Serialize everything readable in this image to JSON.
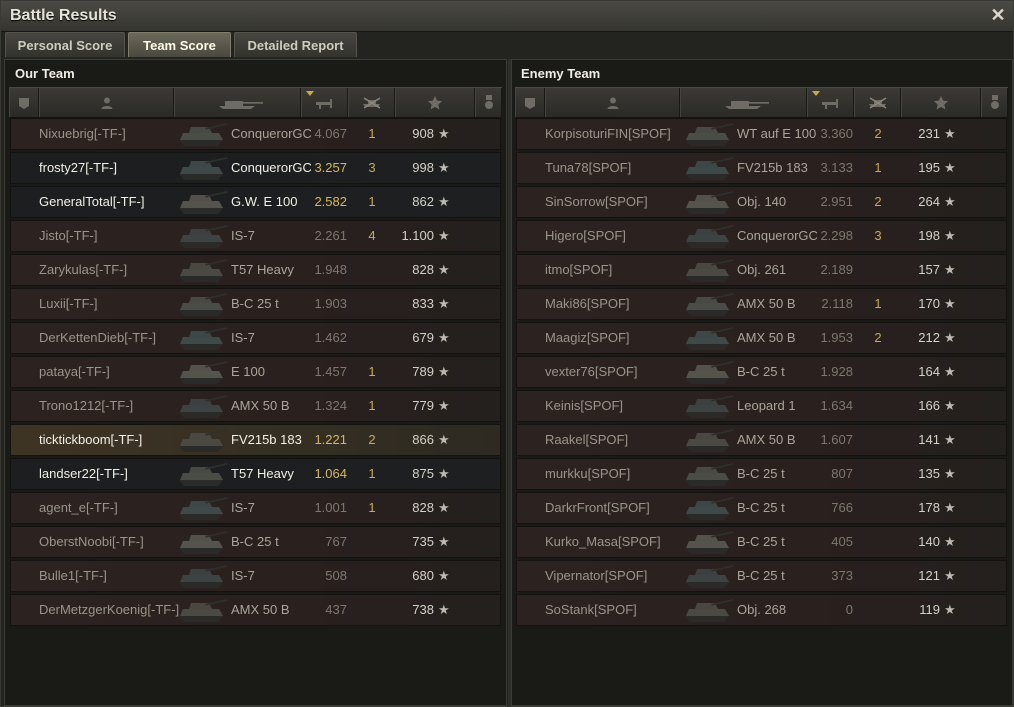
{
  "window": {
    "title": "Battle Results"
  },
  "tabs": [
    {
      "label": "Personal Score"
    },
    {
      "label": "Team Score"
    },
    {
      "label": "Detailed Report"
    }
  ],
  "icons": {
    "header": [
      "platoon-icon",
      "player-icon",
      "tank-icon",
      "damage-icon",
      "kills-icon",
      "xp-star-icon",
      "medal-icon"
    ],
    "close": "close-icon",
    "xp": "star-icon"
  },
  "colors": {
    "accent": "#c9aa58",
    "self_highlight": "#3e3424"
  },
  "our_team": {
    "title": "Our Team",
    "rows": [
      {
        "player": "Nixuebrig[-TF-]",
        "tank": "ConquerorGC",
        "ratio": "4.067",
        "kills": "1",
        "xp": "908",
        "bright": false
      },
      {
        "player": "frosty27[-TF-]",
        "tank": "ConquerorGC",
        "ratio": "3.257",
        "kills": "3",
        "xp": "998",
        "bright": true
      },
      {
        "player": "GeneralTotal[-TF-]",
        "tank": "G.W. E 100",
        "ratio": "2.582",
        "kills": "1",
        "xp": "862",
        "bright": true
      },
      {
        "player": "Jisto[-TF-]",
        "tank": "IS-7",
        "ratio": "2.261",
        "kills": "4",
        "xp": "1.100",
        "bright": false
      },
      {
        "player": "Zarykulas[-TF-]",
        "tank": "T57 Heavy",
        "ratio": "1.948",
        "kills": "",
        "xp": "828",
        "bright": false
      },
      {
        "player": "Luxii[-TF-]",
        "tank": "B-C 25 t",
        "ratio": "1.903",
        "kills": "",
        "xp": "833",
        "bright": false
      },
      {
        "player": "DerKettenDieb[-TF-]",
        "tank": "IS-7",
        "ratio": "1.462",
        "kills": "",
        "xp": "679",
        "bright": false
      },
      {
        "player": "pataya[-TF-]",
        "tank": "E 100",
        "ratio": "1.457",
        "kills": "1",
        "xp": "789",
        "bright": false
      },
      {
        "player": "Trono1212[-TF-]",
        "tank": "AMX 50 B",
        "ratio": "1.324",
        "kills": "1",
        "xp": "779",
        "bright": false
      },
      {
        "player": "ticktickboom[-TF-]",
        "tank": "FV215b 183",
        "ratio": "1.221",
        "kills": "2",
        "xp": "866",
        "bright": true,
        "self": true
      },
      {
        "player": "landser22[-TF-]",
        "tank": "T57 Heavy",
        "ratio": "1.064",
        "kills": "1",
        "xp": "875",
        "bright": true
      },
      {
        "player": "agent_e[-TF-]",
        "tank": "IS-7",
        "ratio": "1.001",
        "kills": "1",
        "xp": "828",
        "bright": false
      },
      {
        "player": "OberstNoobi[-TF-]",
        "tank": "B-C 25 t",
        "ratio": "767",
        "kills": "",
        "xp": "735",
        "bright": false
      },
      {
        "player": "Bulle1[-TF-]",
        "tank": "IS-7",
        "ratio": "508",
        "kills": "",
        "xp": "680",
        "bright": false
      },
      {
        "player": "DerMetzgerKoenig[-TF-]",
        "tank": "AMX 50 B",
        "ratio": "437",
        "kills": "",
        "xp": "738",
        "bright": false
      }
    ]
  },
  "enemy_team": {
    "title": "Enemy Team",
    "rows": [
      {
        "player": "KorpisoturiFIN[SPOF]",
        "tank": "WT auf E 100",
        "ratio": "3.360",
        "kills": "2",
        "xp": "231"
      },
      {
        "player": "Tuna78[SPOF]",
        "tank": "FV215b 183",
        "ratio": "3.133",
        "kills": "1",
        "xp": "195"
      },
      {
        "player": "SinSorrow[SPOF]",
        "tank": "Obj. 140",
        "ratio": "2.951",
        "kills": "2",
        "xp": "264"
      },
      {
        "player": "Higero[SPOF]",
        "tank": "ConquerorGC",
        "ratio": "2.298",
        "kills": "3",
        "xp": "198"
      },
      {
        "player": "itmo[SPOF]",
        "tank": "Obj. 261",
        "ratio": "2.189",
        "kills": "",
        "xp": "157"
      },
      {
        "player": "Maki86[SPOF]",
        "tank": "AMX 50 B",
        "ratio": "2.118",
        "kills": "1",
        "xp": "170"
      },
      {
        "player": "Maagiz[SPOF]",
        "tank": "AMX 50 B",
        "ratio": "1.953",
        "kills": "2",
        "xp": "212"
      },
      {
        "player": "vexter76[SPOF]",
        "tank": "B-C 25 t",
        "ratio": "1.928",
        "kills": "",
        "xp": "164"
      },
      {
        "player": "Keinis[SPOF]",
        "tank": "Leopard 1",
        "ratio": "1.634",
        "kills": "",
        "xp": "166"
      },
      {
        "player": "Raakel[SPOF]",
        "tank": "AMX 50 B",
        "ratio": "1.607",
        "kills": "",
        "xp": "141"
      },
      {
        "player": "murkku[SPOF]",
        "tank": "B-C 25 t",
        "ratio": "807",
        "kills": "",
        "xp": "135"
      },
      {
        "player": "DarkrFront[SPOF]",
        "tank": "B-C 25 t",
        "ratio": "766",
        "kills": "",
        "xp": "178"
      },
      {
        "player": "Kurko_Masa[SPOF]",
        "tank": "B-C 25 t",
        "ratio": "405",
        "kills": "",
        "xp": "140"
      },
      {
        "player": "Vipernator[SPOF]",
        "tank": "B-C 25 t",
        "ratio": "373",
        "kills": "",
        "xp": "121"
      },
      {
        "player": "SoStank[SPOF]",
        "tank": "Obj. 268",
        "ratio": "0",
        "kills": "",
        "xp": "119"
      }
    ]
  }
}
